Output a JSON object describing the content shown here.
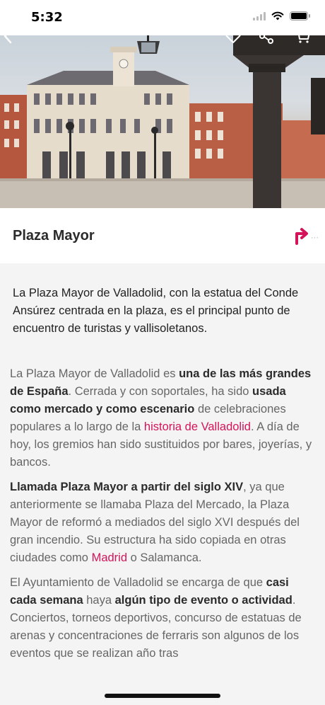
{
  "status": {
    "time": "5:32"
  },
  "place": {
    "title": "Plaza Mayor",
    "intro": "La Plaza Mayor de Valladolid, con la estatua del Conde Ansúrez centrada en la plaza, es el principal punto de encuentro de turistas y vallisoletanos."
  },
  "body": {
    "p1": [
      "La Plaza Mayor de Valladolid es ",
      "una de las más grandes de España",
      ". Cerrada y con soportales, ha sido ",
      "usada como mercado y como escenario",
      " de celebraciones populares a lo largo de la ",
      "historia de Valladolid",
      ". A día de hoy, los gremios han sido sustituidos por bares, joyerías, y bancos."
    ],
    "p2": [
      "Llamada Plaza Mayor a partir del siglo XIV",
      ", ya que anteriormente se llamaba Plaza del Mercado, la Plaza Mayor de reformó a mediados del siglo XVI después del gran incendio. Su estructura ha sido copiada en otras ciudades como ",
      "Madrid",
      " o Salamanca."
    ],
    "p3": [
      "El Ayuntamiento de Valladolid se encarga de que ",
      "casi cada semana",
      " haya ",
      "algún tipo de evento o actividad",
      ". Conciertos, torneos deportivos, concurso de estatuas de arenas y concentraciones de ferraris son algunos de los eventos que se realizan año tras"
    ]
  },
  "colors": {
    "accent": "#d4145a",
    "body_text": "#666666",
    "title_text": "#2b2b2b"
  },
  "icons": {
    "back": "chevron-left-icon",
    "favorite": "heart-icon",
    "share": "share-icon",
    "cart": "cart-icon",
    "directions": "turn-right-arrow-icon"
  }
}
